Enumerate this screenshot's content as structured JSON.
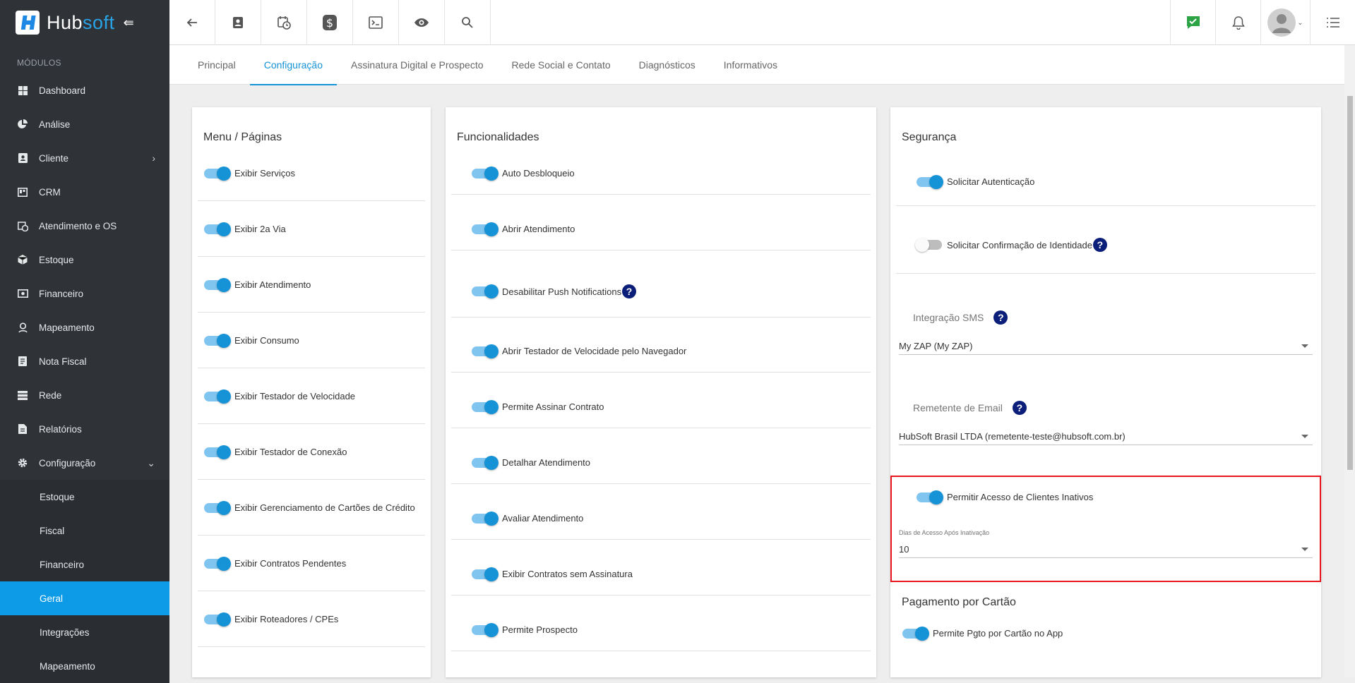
{
  "brand": {
    "name_a": "Hub",
    "name_b": "soft"
  },
  "sidebar": {
    "section": "MÓDULOS",
    "items": [
      {
        "label": "Dashboard",
        "icon": "dashboard-icon"
      },
      {
        "label": "Análise",
        "icon": "pie-chart-icon"
      },
      {
        "label": "Cliente",
        "icon": "contact-card-icon",
        "chevron": "right"
      },
      {
        "label": "CRM",
        "icon": "crm-board-icon"
      },
      {
        "label": "Atendimento e OS",
        "icon": "calendar-clock-icon"
      },
      {
        "label": "Estoque",
        "icon": "box-icon"
      },
      {
        "label": "Financeiro",
        "icon": "money-icon"
      },
      {
        "label": "Mapeamento",
        "icon": "map-pin-icon"
      },
      {
        "label": "Nota Fiscal",
        "icon": "invoice-icon"
      },
      {
        "label": "Rede",
        "icon": "server-icon"
      },
      {
        "label": "Relatórios",
        "icon": "report-icon"
      },
      {
        "label": "Configuração",
        "icon": "gear-icon",
        "chevron": "down"
      }
    ],
    "subitems": [
      "Estoque",
      "Fiscal",
      "Financeiro",
      "Geral",
      "Integrações",
      "Mapeamento"
    ],
    "active_sub": "Geral"
  },
  "tabs": [
    "Principal",
    "Configuração",
    "Assinatura Digital e Prospecto",
    "Rede Social e Contato",
    "Diagnósticos",
    "Informativos"
  ],
  "active_tab": "Configuração",
  "menu_card": {
    "title": "Menu / Páginas",
    "toggles": [
      "Exibir Serviços",
      "Exibir 2a Via",
      "Exibir Atendimento",
      "Exibir Consumo",
      "Exibir Testador de Velocidade",
      "Exibir Testador de Conexão",
      "Exibir Gerenciamento de Cartões de Crédito",
      "Exibir Contratos Pendentes",
      "Exibir Roteadores / CPEs"
    ]
  },
  "func_card": {
    "title": "Funcionalidades",
    "toggles": [
      "Auto Desbloqueio",
      "Abrir Atendimento",
      "Desabilitar Push Notifications",
      "Abrir Testador de Velocidade pelo Navegador",
      "Permite Assinar Contrato",
      "Detalhar Atendimento",
      "Avaliar Atendimento",
      "Exibir Contratos sem Assinatura",
      "Permite Prospecto"
    ]
  },
  "sec_card": {
    "title": "Segurança",
    "auth": "Solicitar Autenticação",
    "identity": "Solicitar Confirmação de Identidade",
    "sms_label": "Integração SMS",
    "sms_value": "My ZAP (My ZAP)",
    "email_label": "Remetente de Email",
    "email_value": "HubSoft Brasil LTDA (remetente-teste@hubsoft.com.br)",
    "inactive": "Permitir Acesso de Clientes Inativos",
    "days_label": "Dias de Acesso Após Inativação",
    "days_value": "10",
    "payment_title": "Pagamento por Cartão",
    "payment_toggle": "Permite Pgto por Cartão no App"
  },
  "help_glyph": "?"
}
